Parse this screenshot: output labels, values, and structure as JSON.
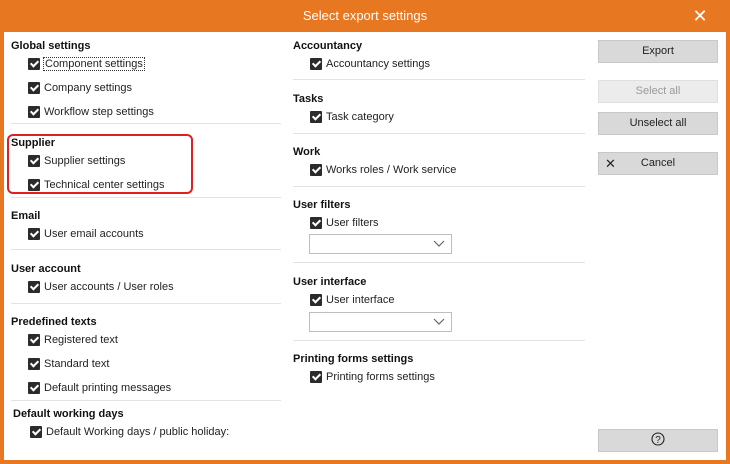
{
  "window": {
    "title": "Select export settings",
    "close_label": "✕"
  },
  "left_sections": [
    {
      "title": "Global settings",
      "items": [
        "Component settings",
        "Company settings",
        "Workflow step settings"
      ]
    },
    {
      "title": "Supplier",
      "items": [
        "Supplier settings",
        "Technical center settings"
      ]
    },
    {
      "title": "Email",
      "items": [
        "User email accounts"
      ]
    },
    {
      "title": "User account",
      "items": [
        "User accounts / User roles"
      ]
    },
    {
      "title": "Predefined texts",
      "items": [
        "Registered text",
        "Standard text",
        "Default printing messages"
      ]
    },
    {
      "title": "Default working days",
      "items": [
        "Default Working days / public holiday:"
      ]
    }
  ],
  "right_sections": [
    {
      "title": "Accountancy",
      "items": [
        "Accountancy settings"
      ]
    },
    {
      "title": "Tasks",
      "items": [
        "Task category"
      ]
    },
    {
      "title": "Work",
      "items": [
        "Works roles / Work service"
      ]
    },
    {
      "title": "User filters",
      "items": [
        "User filters"
      ],
      "combo_value": ""
    },
    {
      "title": "User interface",
      "items": [
        "User interface"
      ],
      "combo_value": ""
    },
    {
      "title": "Printing forms settings",
      "items": [
        "Printing forms settings"
      ]
    }
  ],
  "buttons": {
    "export": "Export",
    "select_all": "Select all",
    "unselect_all": "Unselect all",
    "cancel": "Cancel",
    "help": "?"
  },
  "colors": {
    "title_bar": "#e87722",
    "highlight": "#e02020"
  }
}
